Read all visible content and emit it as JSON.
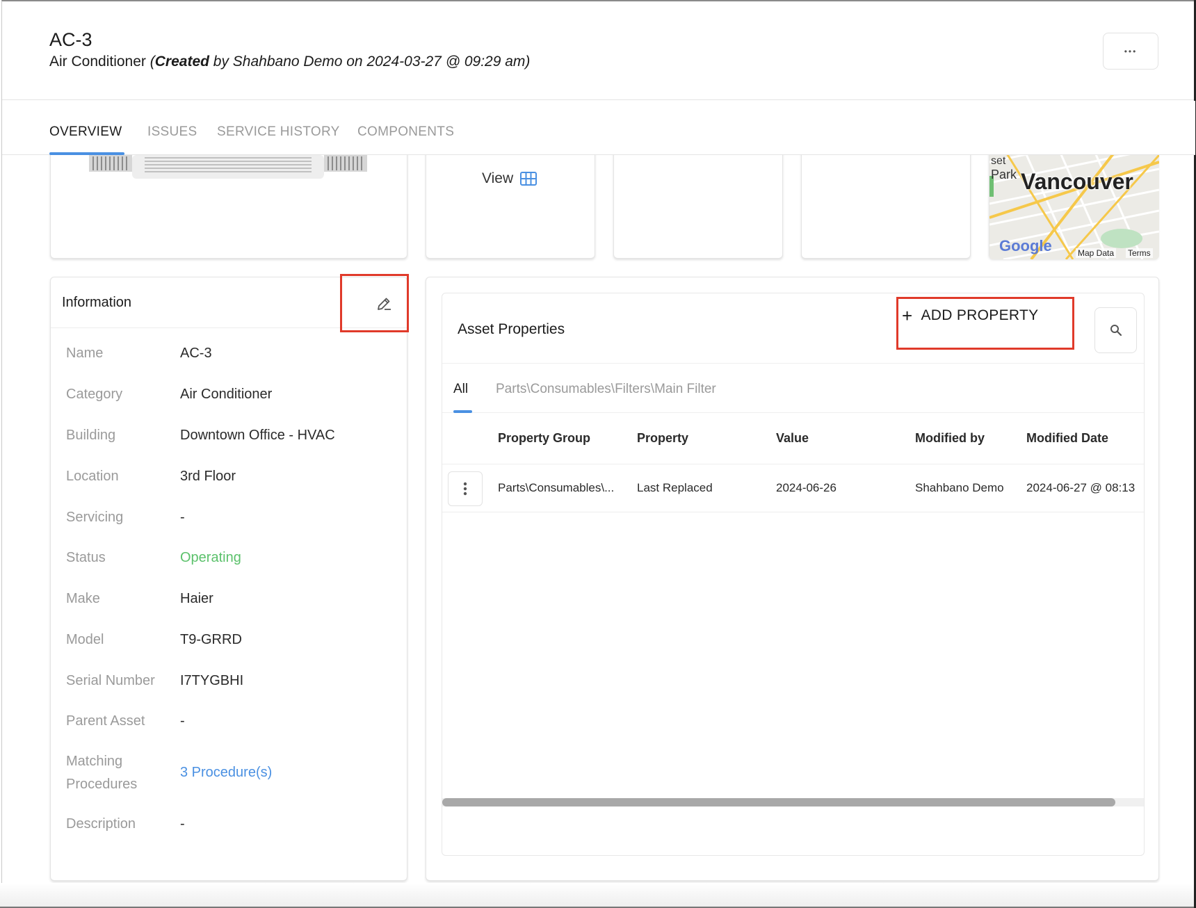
{
  "header": {
    "title": "AC-3",
    "category": "Air Conditioner",
    "meta_open": "(",
    "meta_created": "Created",
    "meta_rest": " by Shahbano Demo on 2024-03-27 @ 09:29 am)",
    "more_label": "•••"
  },
  "tabs": [
    {
      "label": "OVERVIEW"
    },
    {
      "label": "ISSUES"
    },
    {
      "label": "SERVICE HISTORY"
    },
    {
      "label": "COMPONENTS"
    }
  ],
  "media": {
    "view_label": "View",
    "map": {
      "city": "Vancouver",
      "park": "Park",
      "set": "set",
      "google": "Google",
      "map_data": "Map Data",
      "terms": "Terms"
    }
  },
  "information": {
    "title": "Information",
    "fields": [
      {
        "label": "Name",
        "value": "AC-3"
      },
      {
        "label": "Category",
        "value": "Air Conditioner"
      },
      {
        "label": "Building",
        "value": "Downtown Office - HVAC"
      },
      {
        "label": "Location",
        "value": "3rd Floor"
      },
      {
        "label": "Servicing",
        "value": "-"
      },
      {
        "label": "Status",
        "value": "Operating"
      },
      {
        "label": "Make",
        "value": "Haier"
      },
      {
        "label": "Model",
        "value": "T9-GRRD"
      },
      {
        "label": "Serial Number",
        "value": "I7TYGBHI"
      },
      {
        "label": "Parent Asset",
        "value": "-"
      },
      {
        "label": "Matching",
        "label2": "Procedures",
        "value": "3 Procedure(s)"
      },
      {
        "label": "Description",
        "value": "-"
      }
    ]
  },
  "asset_properties": {
    "title": "Asset Properties",
    "add_label": "ADD PROPERTY",
    "add_plus": "+",
    "sub_tabs": [
      {
        "label": "All"
      },
      {
        "label": "Parts\\Consumables\\Filters\\Main Filter"
      }
    ],
    "columns": [
      "Property Group",
      "Property",
      "Value",
      "Modified by",
      "Modified Date"
    ],
    "rows": [
      [
        "Parts\\Consumables\\...",
        "Last Replaced",
        "2024-06-26",
        "Shahbano Demo",
        "2024-06-27 @ 08:13"
      ]
    ]
  },
  "colors": {
    "accent": "#4a90e2",
    "status_operating": "#5bc16b",
    "highlight": "#e03a2a"
  },
  "icons": [
    "more-horizontal-icon",
    "grid-icon",
    "edit-pencil-icon",
    "plus-icon",
    "search-icon",
    "more-vertical-icon"
  ]
}
